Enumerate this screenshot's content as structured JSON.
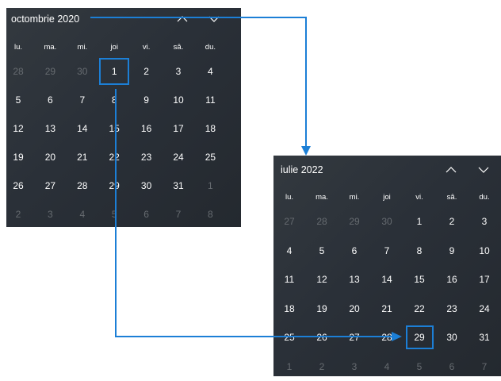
{
  "colors": {
    "calendar_background": "#2d3339",
    "day_text": "#ffffff",
    "muted_day_text": "#666b70",
    "selection_outline": "#1c7fd6",
    "connector_arrow": "#1c7fd6"
  },
  "calendar1": {
    "month_title": "octombrie 2020",
    "prev_icon": "chevron-up-icon",
    "next_icon": "chevron-down-icon",
    "weekdays": [
      "lu.",
      "ma.",
      "mi.",
      "joi",
      "vi.",
      "sâ.",
      "du."
    ],
    "weeks": [
      [
        "28",
        "29",
        "30",
        "1",
        "2",
        "3",
        "4"
      ],
      [
        "5",
        "6",
        "7",
        "8",
        "9",
        "10",
        "11"
      ],
      [
        "12",
        "13",
        "14",
        "15",
        "16",
        "17",
        "18"
      ],
      [
        "19",
        "20",
        "21",
        "22",
        "23",
        "24",
        "25"
      ],
      [
        "26",
        "27",
        "28",
        "29",
        "30",
        "31",
        "1"
      ],
      [
        "2",
        "3",
        "4",
        "5",
        "6",
        "7",
        "8"
      ]
    ],
    "muted": [
      [
        0,
        0
      ],
      [
        0,
        1
      ],
      [
        0,
        2
      ],
      [
        4,
        6
      ],
      [
        5,
        0
      ],
      [
        5,
        1
      ],
      [
        5,
        2
      ],
      [
        5,
        3
      ],
      [
        5,
        4
      ],
      [
        5,
        5
      ],
      [
        5,
        6
      ]
    ],
    "selected": [
      0,
      3
    ]
  },
  "calendar2": {
    "month_title": "iulie 2022",
    "prev_icon": "chevron-up-icon",
    "next_icon": "chevron-down-icon",
    "weekdays": [
      "lu.",
      "ma.",
      "mi.",
      "joi",
      "vi.",
      "sâ.",
      "du."
    ],
    "weeks": [
      [
        "27",
        "28",
        "29",
        "30",
        "1",
        "2",
        "3"
      ],
      [
        "4",
        "5",
        "6",
        "7",
        "8",
        "9",
        "10"
      ],
      [
        "11",
        "12",
        "13",
        "14",
        "15",
        "16",
        "17"
      ],
      [
        "18",
        "19",
        "20",
        "21",
        "22",
        "23",
        "24"
      ],
      [
        "25",
        "26",
        "27",
        "28",
        "29",
        "30",
        "31"
      ],
      [
        "1",
        "2",
        "3",
        "4",
        "5",
        "6",
        "7"
      ]
    ],
    "muted": [
      [
        0,
        0
      ],
      [
        0,
        1
      ],
      [
        0,
        2
      ],
      [
        0,
        3
      ],
      [
        5,
        0
      ],
      [
        5,
        1
      ],
      [
        5,
        2
      ],
      [
        5,
        3
      ],
      [
        5,
        4
      ],
      [
        5,
        5
      ],
      [
        5,
        6
      ]
    ],
    "selected": [
      4,
      4
    ]
  }
}
